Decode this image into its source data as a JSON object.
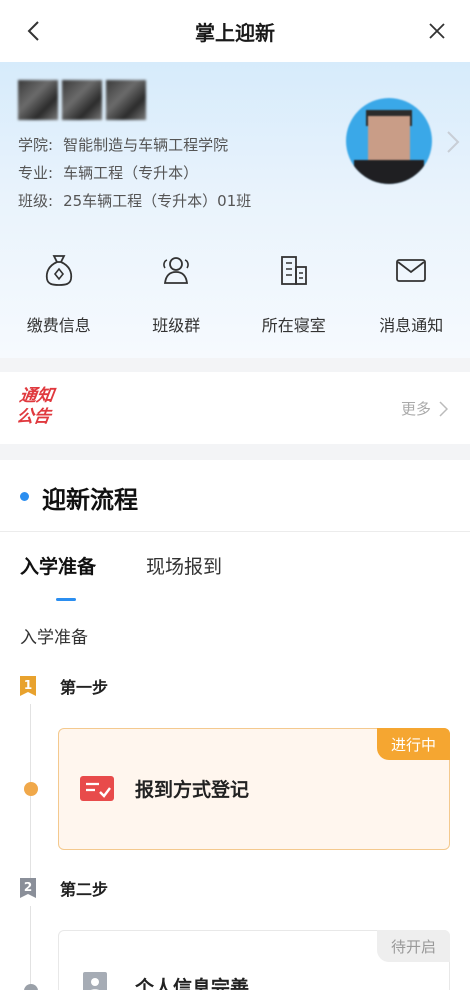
{
  "nav": {
    "title": "掌上迎新",
    "back_icon": "chevron-left-icon",
    "close_icon": "close-icon"
  },
  "profile": {
    "college_label": "学院:",
    "college": "智能制造与车辆工程学院",
    "major_label": "专业:",
    "major": "车辆工程（专升本）",
    "class_label": "班级:",
    "class": "25车辆工程（专升本）01班"
  },
  "quick_menu": [
    {
      "label": "缴费信息",
      "icon": "money-bag-icon"
    },
    {
      "label": "班级群",
      "icon": "group-icon"
    },
    {
      "label": "所在寝室",
      "icon": "building-icon"
    },
    {
      "label": "消息通知",
      "icon": "mail-icon"
    }
  ],
  "notice": {
    "logo_line1": "通知",
    "logo_line2": "公告",
    "more": "更多"
  },
  "flow": {
    "title": "迎新流程",
    "tabs": [
      {
        "label": "入学准备",
        "active": true
      },
      {
        "label": "现场报到",
        "active": false
      }
    ],
    "section_label": "入学准备",
    "steps": [
      {
        "num": "1",
        "label": "第一步",
        "card_title": "报到方式登记",
        "status": "进行中"
      },
      {
        "num": "2",
        "label": "第二步",
        "card_title": "个人信息完善",
        "status": "待开启"
      }
    ]
  },
  "colors": {
    "accent_blue": "#2b8ef0",
    "active_orange": "#f5a631",
    "step1_marker": "#e8a22e",
    "step2_marker": "#8a8f99",
    "notice_red": "#e0393e"
  }
}
